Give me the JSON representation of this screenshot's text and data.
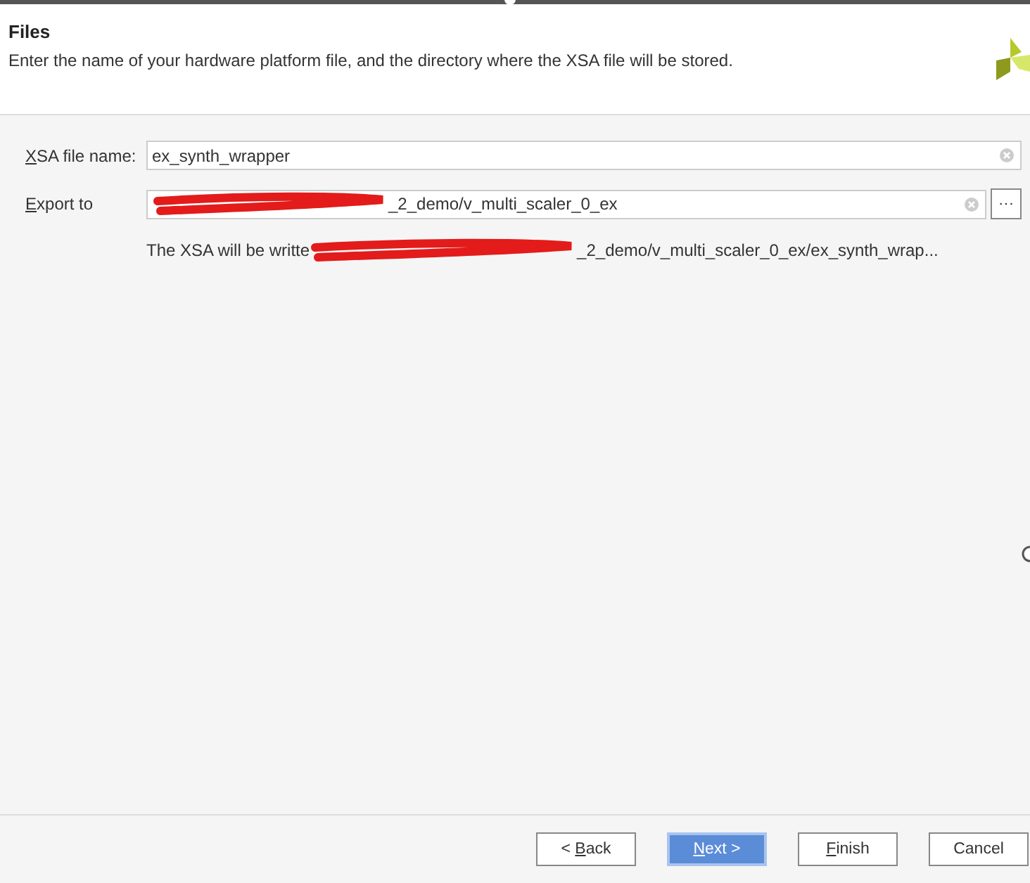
{
  "header": {
    "title": "Files",
    "description": "Enter the name of your hardware platform file, and the directory where the XSA file will be stored."
  },
  "fields": [
    {
      "label": {
        "key": "X",
        "post": "SA file name:"
      },
      "value": "ex_synth_wrapper"
    },
    {
      "label": {
        "key": "E",
        "post": "xport to"
      },
      "value": "_2_demo/v_multi_scaler_0_ex",
      "redacted": true,
      "browse_label": "···"
    }
  ],
  "preview": {
    "before": "The XSA will be writte",
    "after": "_2_demo/v_multi_scaler_0_ex/ex_synth_wrap...",
    "redacted": true
  },
  "buttons": [
    {
      "pre": "< ",
      "key": "B",
      "post": "ack",
      "default": false
    },
    {
      "key": "N",
      "post": "ext >",
      "default": true
    },
    {
      "key": "F",
      "post": "inish",
      "default": false
    },
    {
      "pre": "Cancel",
      "default": false
    }
  ]
}
